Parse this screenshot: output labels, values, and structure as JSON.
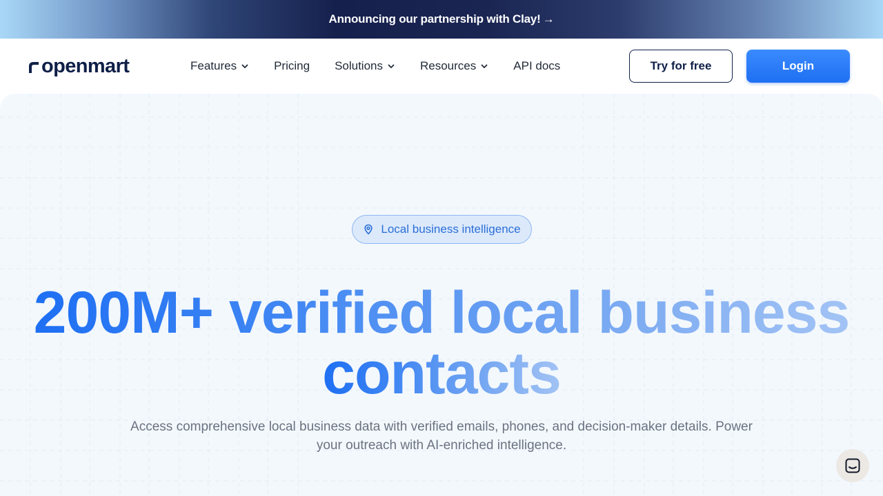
{
  "announcement": {
    "text": "Announcing our partnership with Clay!",
    "arrow": "→"
  },
  "brand": {
    "name": "openmart",
    "logo_icon": "openmart-logo-icon",
    "color": "#0f1f47"
  },
  "nav": {
    "items": [
      {
        "label": "Features",
        "has_dropdown": true
      },
      {
        "label": "Pricing",
        "has_dropdown": false
      },
      {
        "label": "Solutions",
        "has_dropdown": true
      },
      {
        "label": "Resources",
        "has_dropdown": true
      },
      {
        "label": "API docs",
        "has_dropdown": false
      }
    ],
    "try_label": "Try for free",
    "login_label": "Login"
  },
  "hero": {
    "badge_icon": "map-pin-icon",
    "badge_label": "Local business intelligence",
    "headline": "200M+ verified local business contacts",
    "subtitle": "Access comprehensive local business data with verified emails, phones, and decision-maker details. Power your outreach with AI-enriched intelligence."
  },
  "chat_widget": {
    "icon": "chat-bubble-icon"
  },
  "colors": {
    "accent": "#1f6ff2",
    "navy": "#0f1f47",
    "hero_bg": "#f3f8fd"
  }
}
